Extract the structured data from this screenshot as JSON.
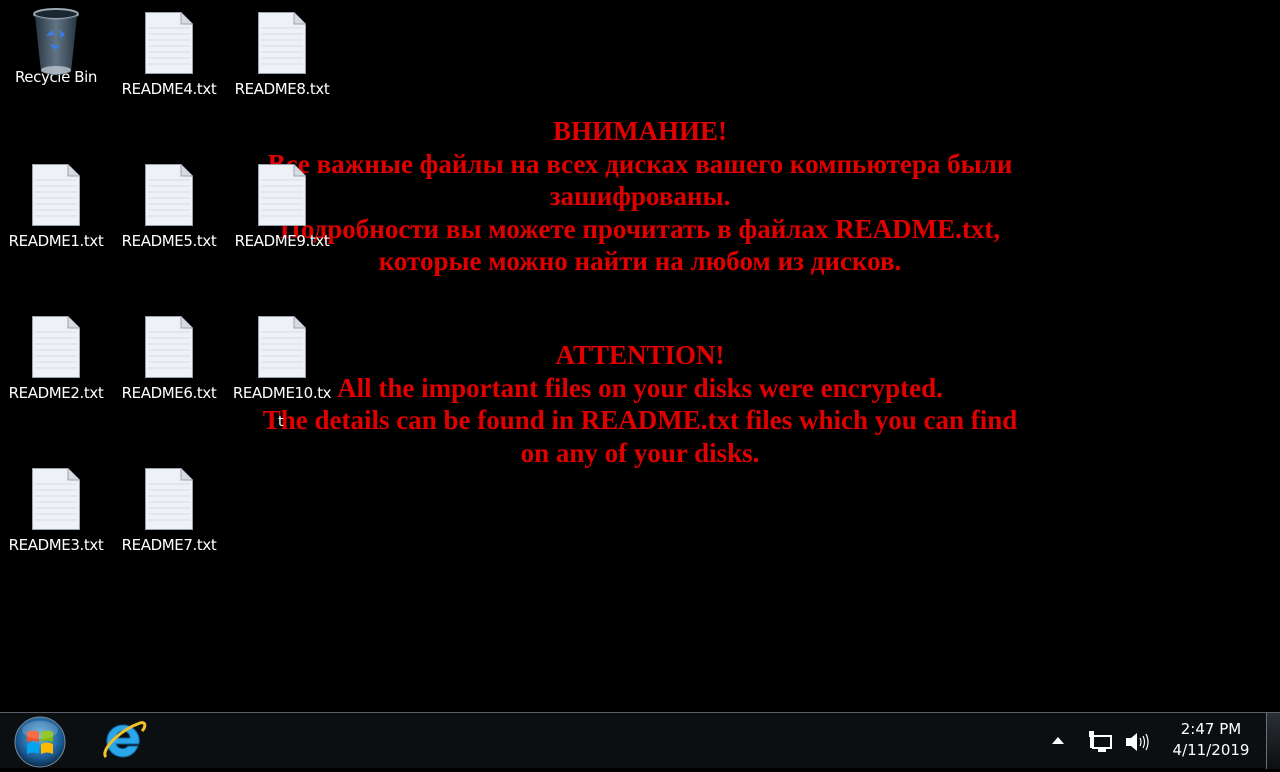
{
  "desktop": {
    "icons": [
      {
        "label": "Recycle Bin",
        "type": "recycle-bin"
      },
      {
        "label": "README4.txt",
        "type": "text-file"
      },
      {
        "label": "README8.txt",
        "type": "text-file"
      },
      {
        "label": "README1.txt",
        "type": "text-file"
      },
      {
        "label": "README5.txt",
        "type": "text-file"
      },
      {
        "label": "README9.txt",
        "type": "text-file"
      },
      {
        "label": "README2.txt",
        "type": "text-file"
      },
      {
        "label": "README6.txt",
        "type": "text-file"
      },
      {
        "label": "README10.tx",
        "type": "text-file"
      },
      {
        "label": "README3.txt",
        "type": "text-file"
      },
      {
        "label": "README7.txt",
        "type": "text-file"
      }
    ],
    "cursor_text": "t"
  },
  "wallpaper": {
    "color": "#e00000",
    "russian": [
      "ВНИМАНИЕ!",
      "Все важные файлы на всех дисках вашего компьютера были",
      "зашифрованы.",
      "Подробности вы можете прочитать в файлах README.txt,",
      "которые можно найти на любом из дисков."
    ],
    "english": [
      "ATTENTION!",
      "All the important files on your disks were encrypted.",
      "The details can be found in README.txt files which you can find",
      "on any of your disks."
    ]
  },
  "taskbar": {
    "start_icon": "windows-start-orb-icon",
    "pinned": [
      {
        "name": "Internet Explorer",
        "icon": "internet-explorer-icon"
      }
    ],
    "tray": {
      "show_hidden_icon": "triangle-up-icon",
      "network_icon": "network-icon",
      "volume_icon": "speaker-icon",
      "time": "2:47 PM",
      "date": "4/11/2019"
    }
  }
}
